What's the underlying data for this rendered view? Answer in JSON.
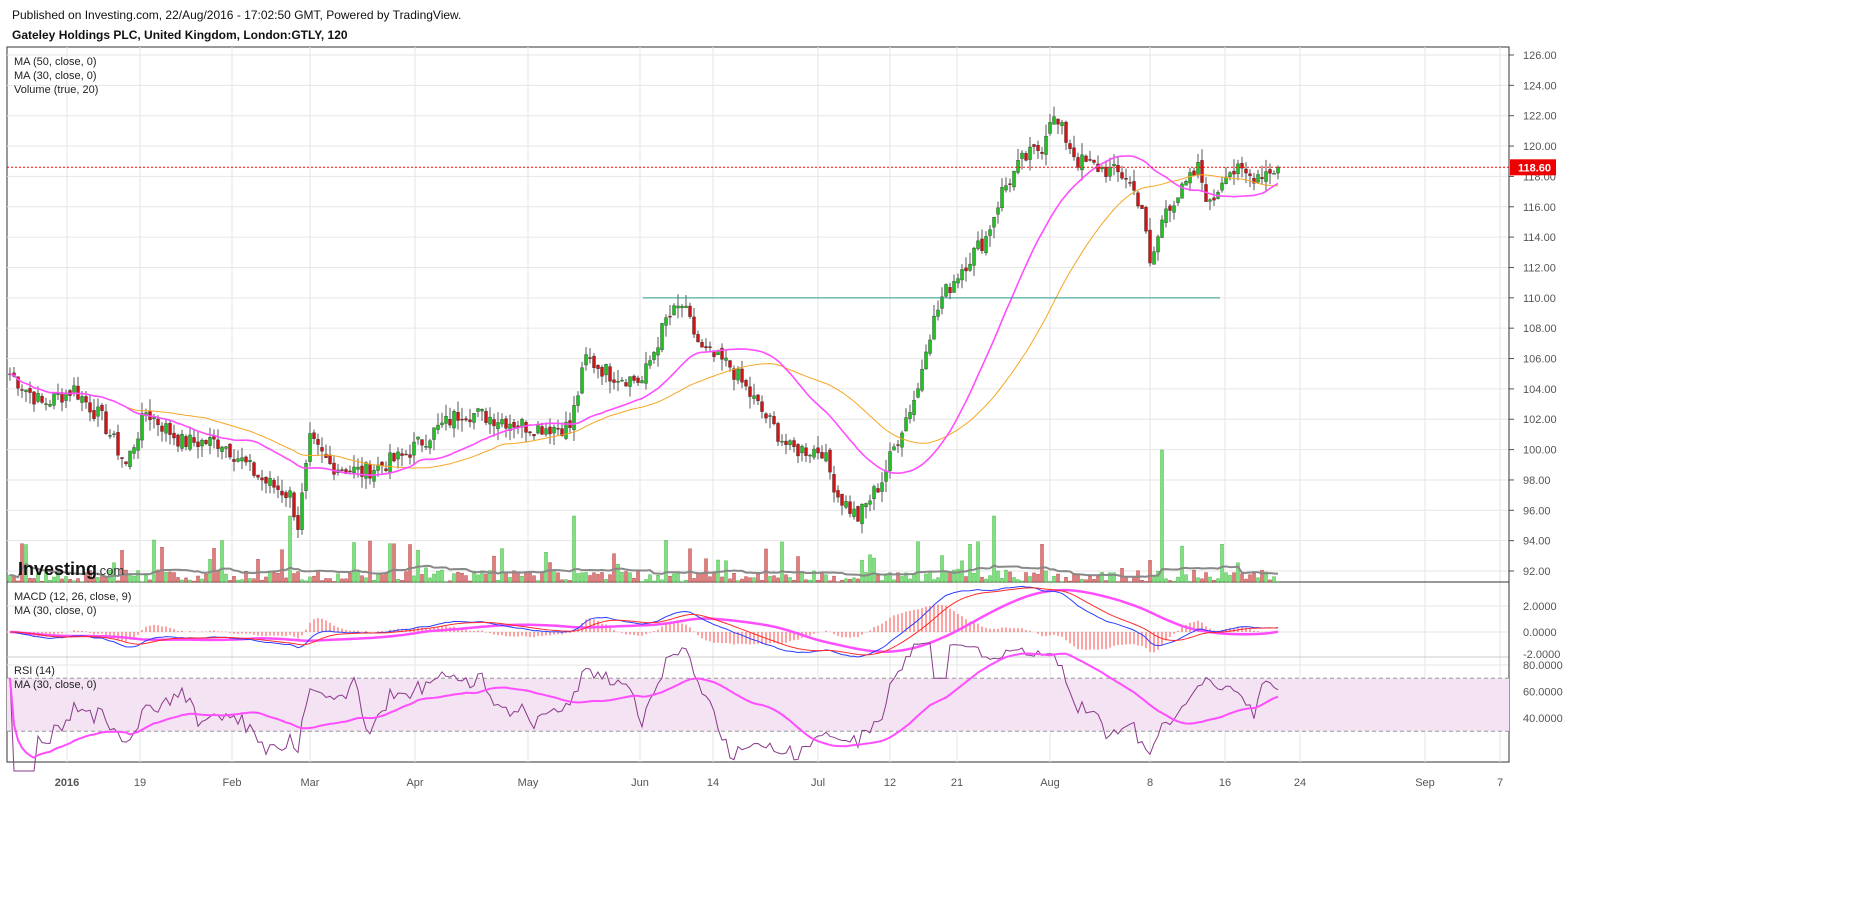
{
  "header": {
    "published": "Published on Investing.com, 22/Aug/2016 - 17:02:50 GMT, Powered by TradingView.",
    "title": "Gateley Holdings PLC, United Kingdom, London:GTLY, 120"
  },
  "legend": {
    "price": [
      "MA (50, close, 0)",
      "MA (30, close, 0)",
      "Volume (true, 20)"
    ],
    "macd": [
      "MACD (12, 26, close, 9)",
      "MA (30, close, 0)"
    ],
    "rsi": [
      "RSI (14)",
      "MA (30, close, 0)"
    ]
  },
  "logo": "Investing.com",
  "colors": {
    "up": "#1fc31f",
    "down": "#d11313",
    "ma50": "#f5a623",
    "ma30": "#ff4dff",
    "macd": "#2b3cff",
    "signal": "#ff2a2a",
    "support": "#2a9d8f",
    "last": "#ff0000"
  },
  "chart_data": {
    "type": "candlestick",
    "price_axis": {
      "ticks": [
        "126.00",
        "124.00",
        "122.00",
        "120.00",
        "118.00",
        "116.00",
        "114.00",
        "112.00",
        "110.00",
        "108.00",
        "106.00",
        "104.00",
        "102.00",
        "100.00",
        "98.00",
        "96.00",
        "94.00",
        "92.00"
      ],
      "range": [
        92,
        126
      ]
    },
    "macd_axis": {
      "ticks": [
        "2.0000",
        "0.0000",
        "-2.0000"
      ]
    },
    "rsi_axis": {
      "ticks": [
        "80.0000",
        "60.0000",
        "40.0000"
      ],
      "band": [
        30,
        70
      ]
    },
    "x_ticks": [
      "2016",
      "19",
      "Feb",
      "Mar",
      "Apr",
      "May",
      "Jun",
      "14",
      "Jul",
      "12",
      "21",
      "Aug",
      "8",
      "16",
      "24",
      "Sep",
      "7"
    ],
    "last_price": "118.60",
    "support_level": 110,
    "close_waypoints": [
      [
        0,
        105
      ],
      [
        8,
        103
      ],
      [
        16,
        104
      ],
      [
        23,
        102
      ],
      [
        29,
        99
      ],
      [
        34,
        102.5
      ],
      [
        43,
        100.5
      ],
      [
        53,
        100.5
      ],
      [
        63,
        98
      ],
      [
        70,
        97
      ],
      [
        72,
        95
      ],
      [
        75,
        100.5
      ],
      [
        80,
        99
      ],
      [
        88,
        98.5
      ],
      [
        98,
        99.5
      ],
      [
        105,
        101
      ],
      [
        113,
        102.5
      ],
      [
        123,
        102
      ],
      [
        130,
        101.5
      ],
      [
        140,
        101.5
      ],
      [
        144,
        106
      ],
      [
        150,
        105
      ],
      [
        158,
        104.5
      ],
      [
        164,
        108.5
      ],
      [
        168,
        109.5
      ],
      [
        173,
        106.5
      ],
      [
        180,
        105.5
      ],
      [
        188,
        102.5
      ],
      [
        195,
        100
      ],
      [
        203,
        100
      ],
      [
        207,
        97
      ],
      [
        212,
        95.5
      ],
      [
        218,
        98
      ],
      [
        223,
        101.5
      ],
      [
        227,
        104
      ],
      [
        229,
        107
      ],
      [
        233,
        110
      ],
      [
        238,
        112
      ],
      [
        244,
        114
      ],
      [
        248,
        117
      ],
      [
        253,
        119
      ],
      [
        258,
        120
      ],
      [
        260,
        122
      ],
      [
        263,
        121
      ],
      [
        267,
        119
      ],
      [
        273,
        118.5
      ],
      [
        279,
        118
      ],
      [
        283,
        116
      ],
      [
        285,
        112
      ],
      [
        289,
        116
      ],
      [
        293,
        117
      ],
      [
        297,
        118.5
      ],
      [
        300,
        116
      ],
      [
        304,
        118.5
      ],
      [
        310,
        118
      ],
      [
        317,
        118.6
      ]
    ]
  }
}
